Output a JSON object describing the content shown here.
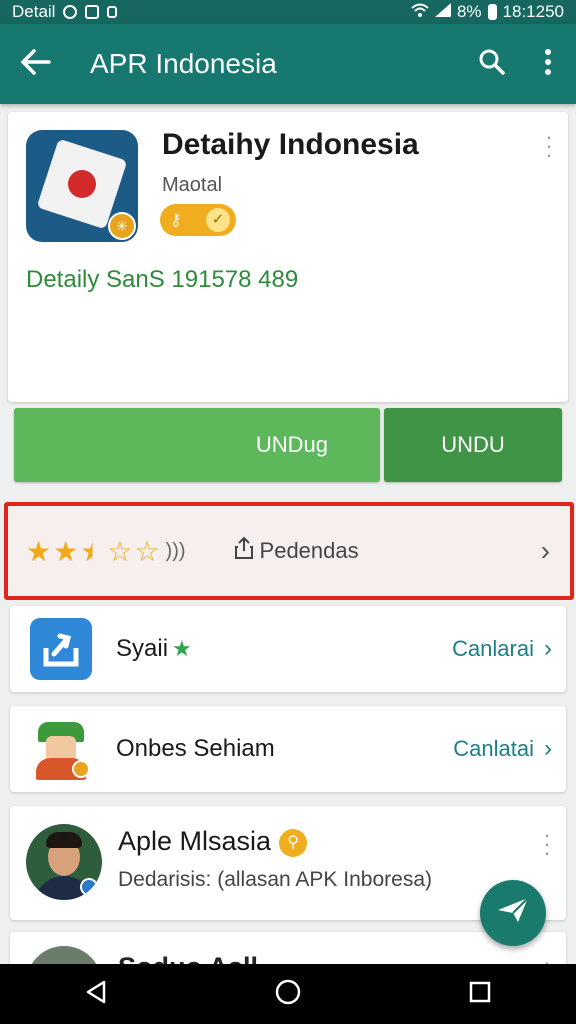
{
  "status_bar": {
    "left_text": "Detail",
    "battery_text": "8%",
    "time": "18:1250"
  },
  "app_bar": {
    "title": "APR Indonesia",
    "back_icon": "arrow-left-icon",
    "search_icon": "search-icon",
    "menu_icon": "more-vert-icon"
  },
  "app_detail": {
    "name": "Detaihy Indonesia",
    "subtitle": "Maotal",
    "size_text": "Detaily SanS 191578 489"
  },
  "buttons": {
    "primary": "UNDug",
    "secondary": "UNDU"
  },
  "rating": {
    "stars": 2.5,
    "max_stars": 5,
    "label": "Pedendas"
  },
  "list": [
    {
      "label": "Syaii",
      "action": "Canlarai",
      "icon_color": "#2f87d8"
    },
    {
      "label": "Onbes Sehiam",
      "action": "Canlatai",
      "icon_color": "#3c9a3c"
    }
  ],
  "profile": {
    "name": "Aple Mlsasia",
    "description": "Dedarisis: (allasan APK Inboresa)"
  },
  "partial_item": {
    "name": "Soduo Asll"
  },
  "colors": {
    "app_bar": "#16786f",
    "primary_button": "#5cb85a",
    "secondary_button": "#3f9446",
    "highlight_border": "#e0241e",
    "accent_text": "#1d7f86"
  }
}
